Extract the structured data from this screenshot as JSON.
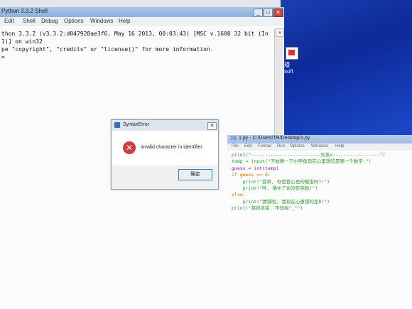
{
  "shell": {
    "title": "Python 3.3.2 Shell",
    "menu": [
      "Edit",
      "Shell",
      "Debug",
      "Options",
      "Windows",
      "Help"
    ],
    "lines": [
      "thon 3.3.2 (v3.3.2:d047928ae3f6, May 16 2013, 00:03:43) [MSC v.1600 32 bit (In",
      "1)] on win32",
      "pe \"copyright\", \"credits\" or \"license()\" for more information.",
      ">"
    ]
  },
  "desktop": {
    "label1": "瑾",
    "label2": "soft"
  },
  "dialog": {
    "title": "SyntaxError",
    "message": "invalid character in identifier",
    "ok_label": "确定"
  },
  "editor": {
    "title": "1.py - C:/Users/TB/Desktop/1.py",
    "menu": [
      "File",
      "Edit",
      "Format",
      "Run",
      "Options",
      "Windows",
      "Help"
    ],
    "code": [
      "print(\"-------------------------刘发x-----------------\")",
      "temp = input(\"不妨猜一下小甲鱼现在心里想的是哪一个数字:\")",
      "guess = int(temp)",
      "if guess == 8:",
      "    print(\"我草, 你是我心里的蛔虫吗?!\")",
      "    print(\"哼, 猜中了也没有奖励!\")",
      "else:",
      "    print(\"猜错啦, 我现在心里想的是8!\")",
      "print(\"游戏结束, 不玩啦^_^\")"
    ]
  },
  "colors": {
    "string": "#2a9a2a",
    "keyword": "#e06a00",
    "builtin": "#8a1aa8"
  }
}
